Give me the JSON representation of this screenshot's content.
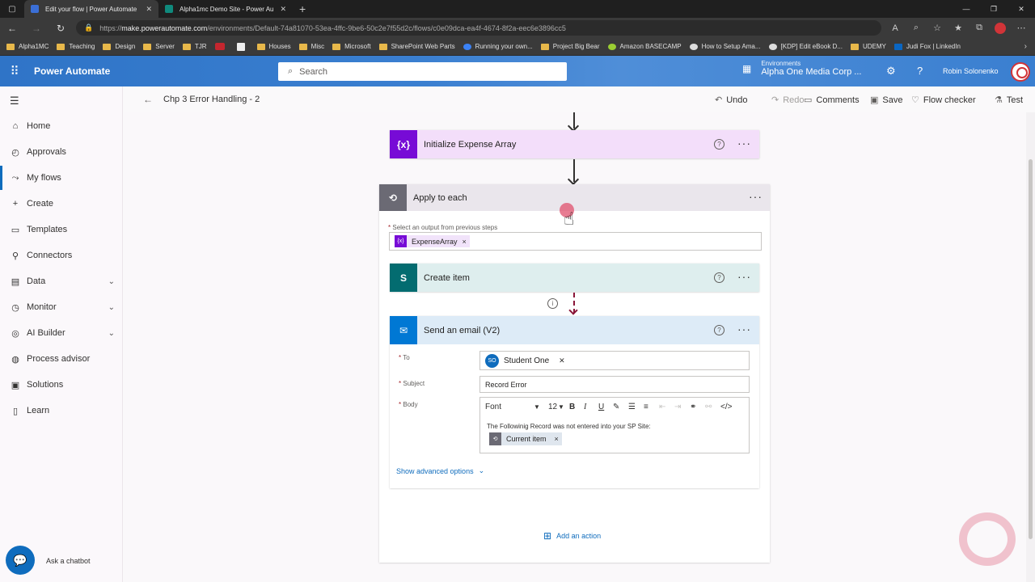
{
  "browser": {
    "tabs": [
      {
        "title": "Edit your flow | Power Automate",
        "active": true
      },
      {
        "title": "Alpha1mc Demo Site - Power Au",
        "active": false
      }
    ],
    "url_prefix": "https://",
    "url_domain": "make.powerautomate.com",
    "url_path": "/environments/Default-74a81070-53ea-4ffc-9be6-50c2e7f55d2c/flows/c0e09dca-ea4f-4674-8f2a-eec6e3896cc5",
    "bookmarks": [
      "Alpha1MC",
      "Teaching",
      "Design",
      "Server",
      "TJR",
      "",
      "",
      "Houses",
      "Misc",
      "Microsoft",
      "SharePoint Web Parts",
      "Running your own...",
      "Project Big Bear",
      "Amazon BASECAMP",
      "How to Setup Ama...",
      "[KDP] Edit eBook D...",
      "UDEMY",
      "Judi Fox | LinkedIn"
    ]
  },
  "header": {
    "app_name": "Power Automate",
    "search_placeholder": "Search",
    "env_label": "Environments",
    "env_name": "Alpha One Media Corp ...",
    "user_name": "Robin Solonenko"
  },
  "nav": {
    "items": [
      {
        "label": "Home",
        "icon": "home-icon",
        "glyph": "⌂"
      },
      {
        "label": "Approvals",
        "icon": "approvals-icon",
        "glyph": "◴"
      },
      {
        "label": "My flows",
        "icon": "flow-icon",
        "glyph": "⤳",
        "selected": true
      },
      {
        "label": "Create",
        "icon": "plus-icon",
        "glyph": "+"
      },
      {
        "label": "Templates",
        "icon": "templates-icon",
        "glyph": "▭"
      },
      {
        "label": "Connectors",
        "icon": "connectors-icon",
        "glyph": "⚲"
      },
      {
        "label": "Data",
        "icon": "data-icon",
        "glyph": "▤",
        "expandable": true
      },
      {
        "label": "Monitor",
        "icon": "monitor-icon",
        "glyph": "◷",
        "expandable": true
      },
      {
        "label": "AI Builder",
        "icon": "ai-builder-icon",
        "glyph": "◎",
        "expandable": true
      },
      {
        "label": "Process advisor",
        "icon": "process-advisor-icon",
        "glyph": "◍"
      },
      {
        "label": "Solutions",
        "icon": "solutions-icon",
        "glyph": "▣"
      },
      {
        "label": "Learn",
        "icon": "learn-icon",
        "glyph": "▯"
      }
    ],
    "chatbot_label": "Ask a chatbot"
  },
  "commandbar": {
    "flow_name": "Chp 3 Error Handling - 2",
    "undo": "Undo",
    "redo": "Redo",
    "comments": "Comments",
    "save": "Save",
    "flow_checker": "Flow checker",
    "test": "Test"
  },
  "flow": {
    "init_action": {
      "title": "Initialize Expense Array",
      "icon_text": "{x}",
      "color": "#770bd6"
    },
    "apply_each": {
      "title": "Apply to each",
      "select_label": "Select an output from previous steps",
      "token": "ExpenseArray"
    },
    "create_item": {
      "title": "Create item",
      "icon_text": "S",
      "color": "#036c70"
    },
    "send_email": {
      "title": "Send an email (V2)",
      "color": "#0078d4",
      "to_label": "To",
      "to_token_initials": "SO",
      "to_token": "Student One",
      "subject_label": "Subject",
      "subject_value": "Record Error",
      "body_label": "Body",
      "font_label": "Font",
      "font_size": "12",
      "body_text": "The Followinig Record was not entered into your SP Site:",
      "body_token": "Current item",
      "show_advanced": "Show advanced options"
    },
    "add_action": "Add an action"
  }
}
